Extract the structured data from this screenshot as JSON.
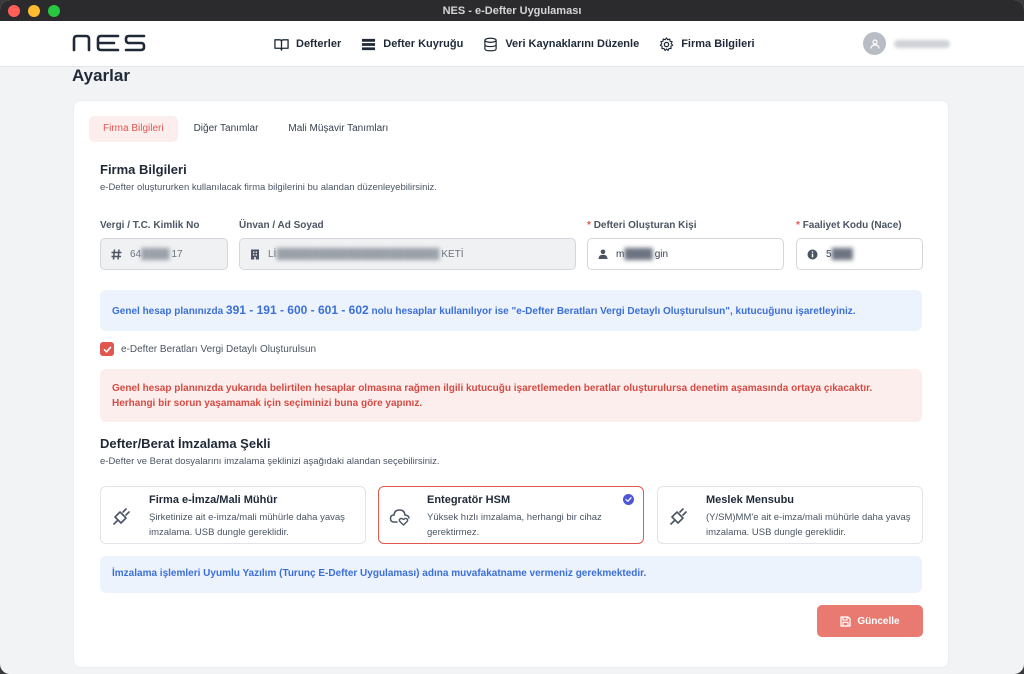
{
  "window": {
    "title": "NES - e-Defter Uygulaması"
  },
  "nav": {
    "items": [
      {
        "label": "Defterler",
        "icon": "book-icon"
      },
      {
        "label": "Defter Kuyruğu",
        "icon": "list-icon"
      },
      {
        "label": "Veri Kaynaklarını Düzenle",
        "icon": "database-icon"
      },
      {
        "label": "Firma Bilgileri",
        "icon": "gear-icon"
      }
    ]
  },
  "page": {
    "title": "Ayarlar"
  },
  "tabs": [
    {
      "label": "Firma Bilgileri",
      "active": true
    },
    {
      "label": "Diğer Tanımlar",
      "active": false
    },
    {
      "label": "Mali Müşavir Tanımları",
      "active": false
    }
  ],
  "firma": {
    "title": "Firma Bilgileri",
    "description": "e-Defter oluştururken kullanılacak firma bilgilerini bu alandan düzenleyebilirsiniz.",
    "fields": {
      "vergi": {
        "label": "Vergi / T.C. Kimlik No",
        "value_prefix": "64",
        "value_suffix": "17"
      },
      "unvan": {
        "label": "Ünvan / Ad Soyad",
        "value_prefix": "Lİ",
        "value_suffix": "KETİ"
      },
      "kisi": {
        "label": "Defteri Oluşturan Kişi",
        "required": "*",
        "value_prefix": "m",
        "value_suffix": "gin"
      },
      "nace": {
        "label": "Faaliyet Kodu (Nace)",
        "required": "*",
        "value_prefix": "5"
      }
    }
  },
  "info1": {
    "pre": "Genel hesap planınızda ",
    "accounts": "391 - 191 - 600 - 601 - 602",
    "mid": " nolu hesaplar kullanılıyor ise \"",
    "strong": "e-Defter Beratları Vergi Detaylı Oluşturulsun",
    "post": "\", kutucuğunu işaretleyiniz."
  },
  "checkbox": {
    "label": "e-Defter Beratları Vergi Detaylı Oluşturulsun",
    "checked": true
  },
  "warning": {
    "line1": "Genel hesap planınızda yukarıda belirtilen hesaplar olmasına rağmen ilgili kutucuğu işaretlemeden beratlar oluşturulursa denetim aşamasında ortaya çıkacaktır.",
    "line2": "Herhangi bir sorun yaşamamak için seçiminizi buna göre yapınız."
  },
  "imza": {
    "title": "Defter/Berat İmzalama Şekli",
    "description": "e-Defter ve Berat dosyalarını imzalama şeklinizi aşağıdaki alandan seçebilirsiniz.",
    "options": [
      {
        "title": "Firma e-İmza/Mali Mühür",
        "desc": "Şirketinize ait e-imza/mali mühürle daha yavaş imzalama. USB dungle gereklidir.",
        "icon": "usb-plug-icon",
        "selected": false
      },
      {
        "title": "Entegratör HSM",
        "desc": "Yüksek hızlı imzalama, herhangi bir cihaz gerektirmez.",
        "icon": "cloud-heart-icon",
        "selected": true
      },
      {
        "title": "Meslek Mensubu",
        "desc": "(Y/SM)MM'e ait e-imza/mali mühürle daha yavaş imzalama. USB dungle gereklidir.",
        "icon": "usb-plug-icon",
        "selected": false
      }
    ]
  },
  "info2": {
    "pre": "İmzalama işlemleri ",
    "strong": "Uyumlu Yazılım (Turunç E-Defter Uygulaması)",
    "post": " adına muvafakatname vermeniz gerekmektedir."
  },
  "actions": {
    "update_label": "Güncelle"
  },
  "colors": {
    "accent": "#e0574f",
    "info_blue": "#3b6fd8",
    "selected_badge": "#4b56d9"
  }
}
